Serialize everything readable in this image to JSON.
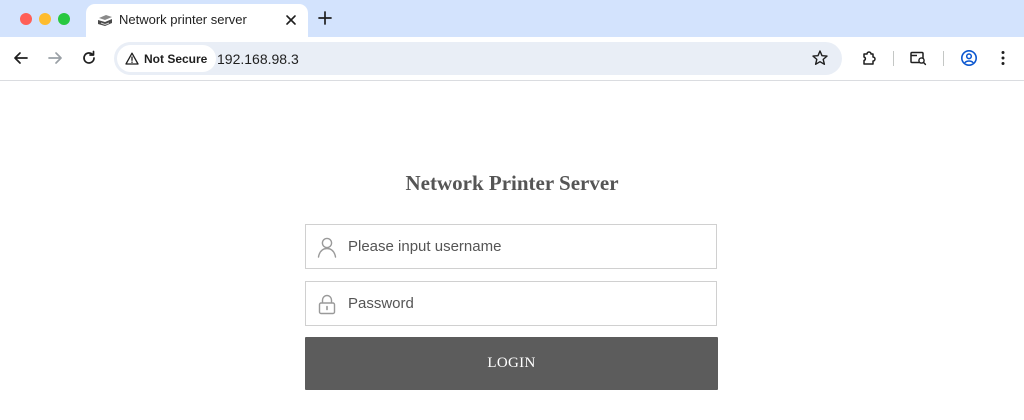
{
  "browser": {
    "tab": {
      "title": "Network printer server",
      "favicon": "printer-icon"
    },
    "address_bar": {
      "security_label": "Not Secure",
      "url": "192.168.98.3"
    },
    "colors": {
      "tabstrip": "#d3e3fd",
      "omnibox": "#e9eef6"
    }
  },
  "page": {
    "title": "Network Printer Server",
    "username": {
      "placeholder": "Please input username",
      "value": "",
      "icon": "user-icon"
    },
    "password": {
      "placeholder": "Password",
      "value": "",
      "icon": "lock-icon"
    },
    "login_label": "LOGIN",
    "colors": {
      "title": "#555555",
      "button": "#5c5c5c"
    }
  }
}
